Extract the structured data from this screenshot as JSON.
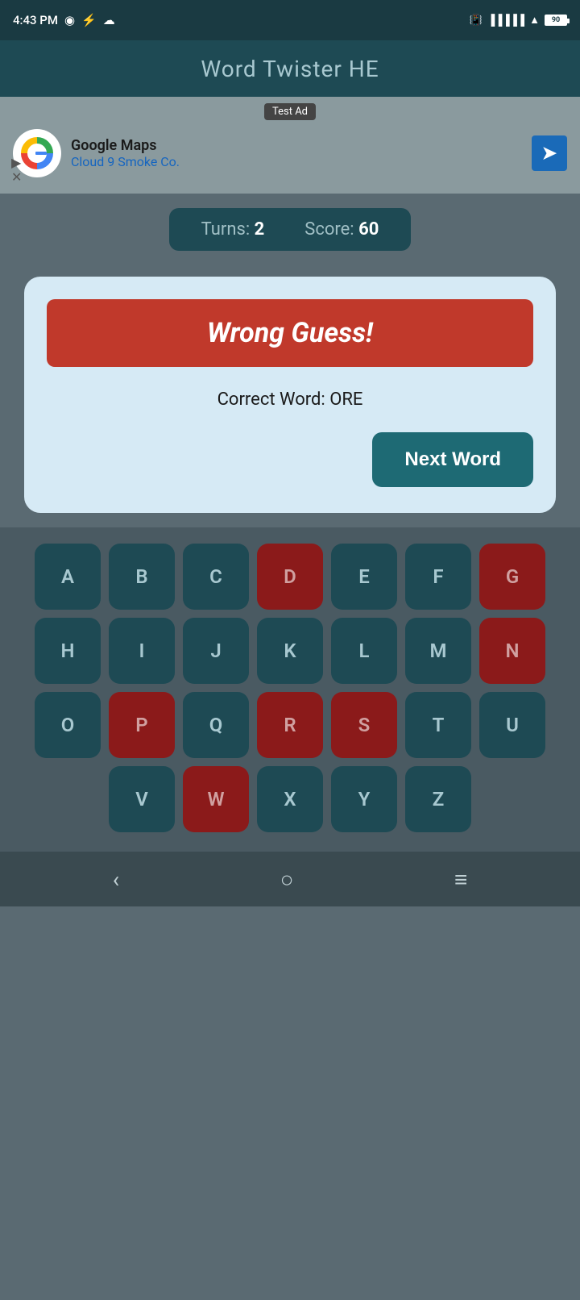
{
  "statusBar": {
    "time": "4:43 PM",
    "battery": "90"
  },
  "appHeader": {
    "title": "Word Twister HE"
  },
  "ad": {
    "label": "Test Ad",
    "companyName": "Google Maps",
    "companySubtitle": "Cloud 9 Smoke Co."
  },
  "scoreBar": {
    "turnsLabel": "Turns:",
    "turnsValue": "2",
    "scoreLabel": "Score:",
    "scoreValue": "60"
  },
  "dialog": {
    "wrongGuessLabel": "Wrong Guess!",
    "correctWordLabel": "Correct Word: ORE",
    "nextWordLabel": "Next Word"
  },
  "keyboard": {
    "rows": [
      [
        "A",
        "B",
        "C",
        "D",
        "E",
        "F",
        "G"
      ],
      [
        "H",
        "I",
        "J",
        "K",
        "L",
        "M",
        "N"
      ],
      [
        "O",
        "P",
        "Q",
        "R",
        "S",
        "T",
        "U"
      ],
      [
        "V",
        "W",
        "X",
        "Y",
        "Z"
      ]
    ],
    "usedKeys": [
      "D",
      "G",
      "N",
      "P",
      "R",
      "S",
      "W"
    ]
  },
  "navBar": {
    "back": "‹",
    "home": "○",
    "menu": "≡"
  },
  "colors": {
    "used": "#8b1a1a",
    "normal": "#1e4a54",
    "accent": "#1e6a74",
    "wrong": "#c0392b"
  }
}
